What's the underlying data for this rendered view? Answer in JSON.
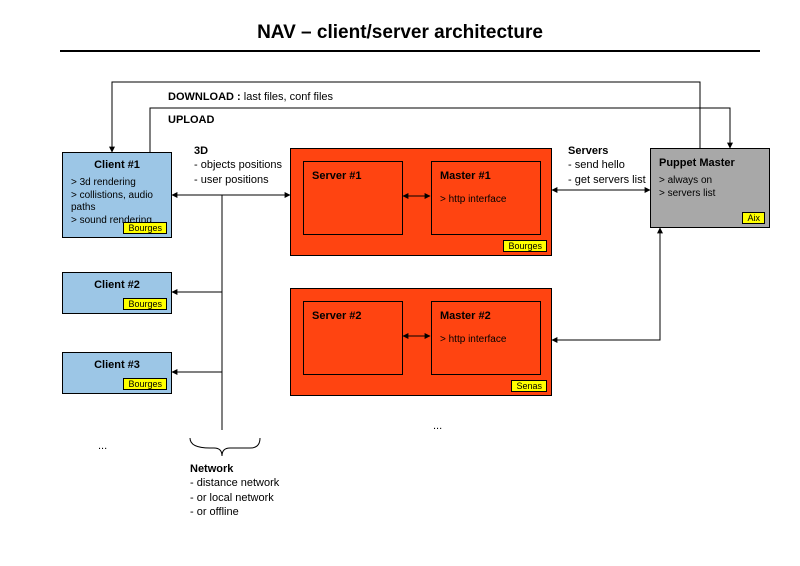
{
  "title": "NAV – client/server architecture",
  "download_label": "DOWNLOAD :",
  "download_desc": "last files, conf files",
  "upload_label": "UPLOAD",
  "three_d_label": "3D",
  "three_d_desc_1": "- objects positions",
  "three_d_desc_2": "- user positions",
  "servers_label": "Servers",
  "servers_desc_1": "- send hello",
  "servers_desc_2": "- get servers list",
  "network_label": "Network",
  "network_desc_1": "- distance network",
  "network_desc_2": "- or local network",
  "network_desc_3": "- or offline",
  "ellipsis": "...",
  "clients": [
    {
      "title": "Client #1",
      "features": [
        "> 3d rendering",
        "> collistions, audio paths",
        "> sound rendering"
      ],
      "tag": "Bourges"
    },
    {
      "title": "Client #2",
      "features": [],
      "tag": "Bourges"
    },
    {
      "title": "Client #3",
      "features": [],
      "tag": "Bourges"
    }
  ],
  "clusters": [
    {
      "tag": "Bourges",
      "server": {
        "title": "Server #1"
      },
      "master": {
        "title": "Master #1",
        "desc": "> http interface"
      }
    },
    {
      "tag": "Senas",
      "server": {
        "title": "Server #2"
      },
      "master": {
        "title": "Master #2",
        "desc": "> http interface"
      }
    }
  ],
  "puppet": {
    "title": "Puppet Master",
    "features": [
      "> always on",
      "> servers list"
    ],
    "tag": "Aix"
  }
}
